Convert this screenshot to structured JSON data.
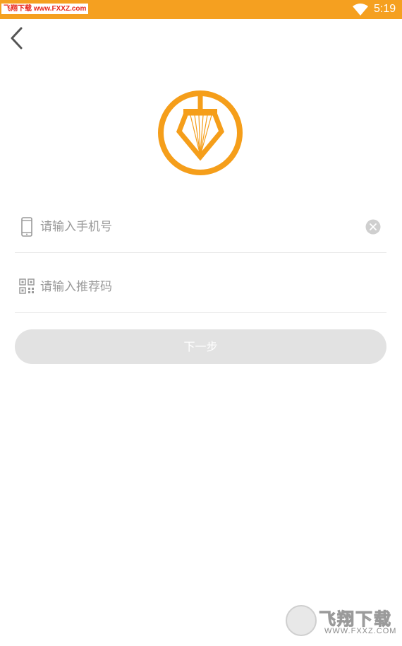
{
  "status_bar": {
    "watermark": "飞翔下载 www.FXXZ.com",
    "time": "5:19",
    "wifi_icon": "wifi-icon",
    "background_color": "#f5a020"
  },
  "header": {
    "back_icon": "chevron-left-icon"
  },
  "logo": {
    "icon": "diamond-logo-icon",
    "color": "#f5a020"
  },
  "form": {
    "phone": {
      "icon": "phone-icon",
      "placeholder": "请输入手机号",
      "value": "",
      "clear_icon": "clear-icon"
    },
    "referral": {
      "icon": "qr-code-icon",
      "placeholder": "请输入推荐码",
      "value": ""
    },
    "next_label": "下一步",
    "next_button_color": "#e2e2e2"
  },
  "watermark_bottom": {
    "text": "飞翔下载",
    "url": "WWW.FXXZ.COM"
  }
}
